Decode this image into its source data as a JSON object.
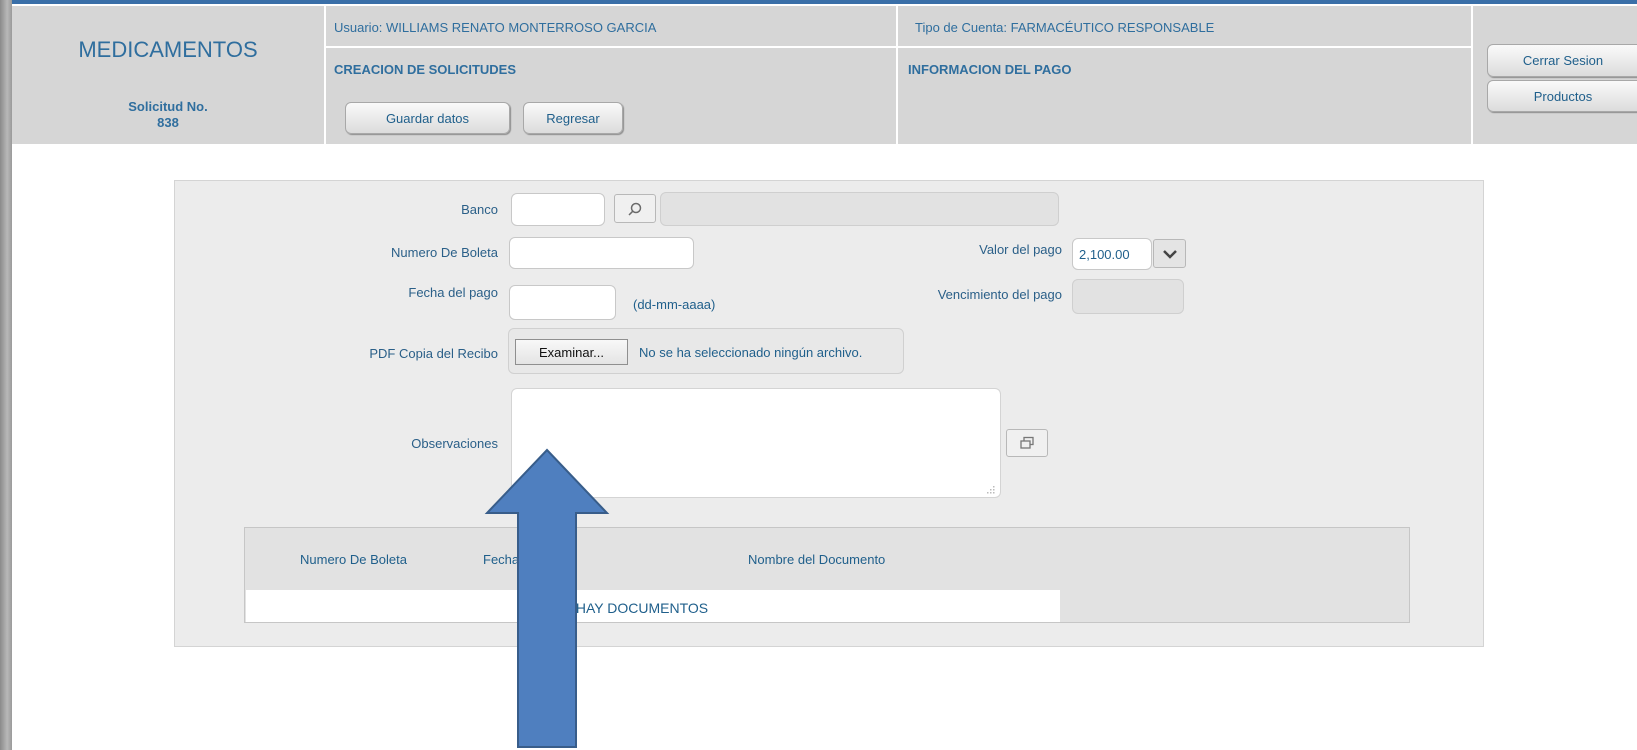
{
  "header": {
    "app_title": "MEDICAMENTOS",
    "request_label": "Solicitud No.",
    "request_number": "838",
    "user_text": "Usuario: WILLIAMS RENATO MONTERROSO GARCIA",
    "account_type_text": "Tipo de Cuenta: FARMACÉUTICO RESPONSABLE",
    "section_title": "CREACION DE SOLICITUDES",
    "subsection_title": "INFORMACION DEL PAGO",
    "save_button": "Guardar datos",
    "back_button": "Regresar",
    "logout_button": "Cerrar Sesion",
    "products_button": "Productos"
  },
  "form": {
    "bank_label": "Banco",
    "bank_code_value": "",
    "bank_name_value": "",
    "receipt_number_label": "Numero De Boleta",
    "receipt_number_value": "",
    "payment_value_label": "Valor del pago",
    "payment_value": "2,100.00",
    "payment_date_label": "Fecha del pago",
    "payment_date_value": "",
    "date_format_hint": "(dd-mm-aaaa)",
    "payment_due_label": "Vencimiento del pago",
    "payment_due_value": "",
    "pdf_label": "PDF Copia del Recibo",
    "browse_button": "Examinar...",
    "no_file_text": "No se ha seleccionado ningún archivo.",
    "observations_label": "Observaciones",
    "observations_value": ""
  },
  "documents_table": {
    "columns": [
      "Numero De Boleta",
      "Fecha del Pago",
      "Nombre del Documento"
    ],
    "empty_message": "NO HAY DOCUMENTOS"
  },
  "annotation": {
    "arrow_color": "#4f7fbf",
    "arrow_border": "#385d8a"
  },
  "icons": {
    "search": "search-icon",
    "dropdown": "chevron-down-icon",
    "expand": "expand-icon"
  }
}
